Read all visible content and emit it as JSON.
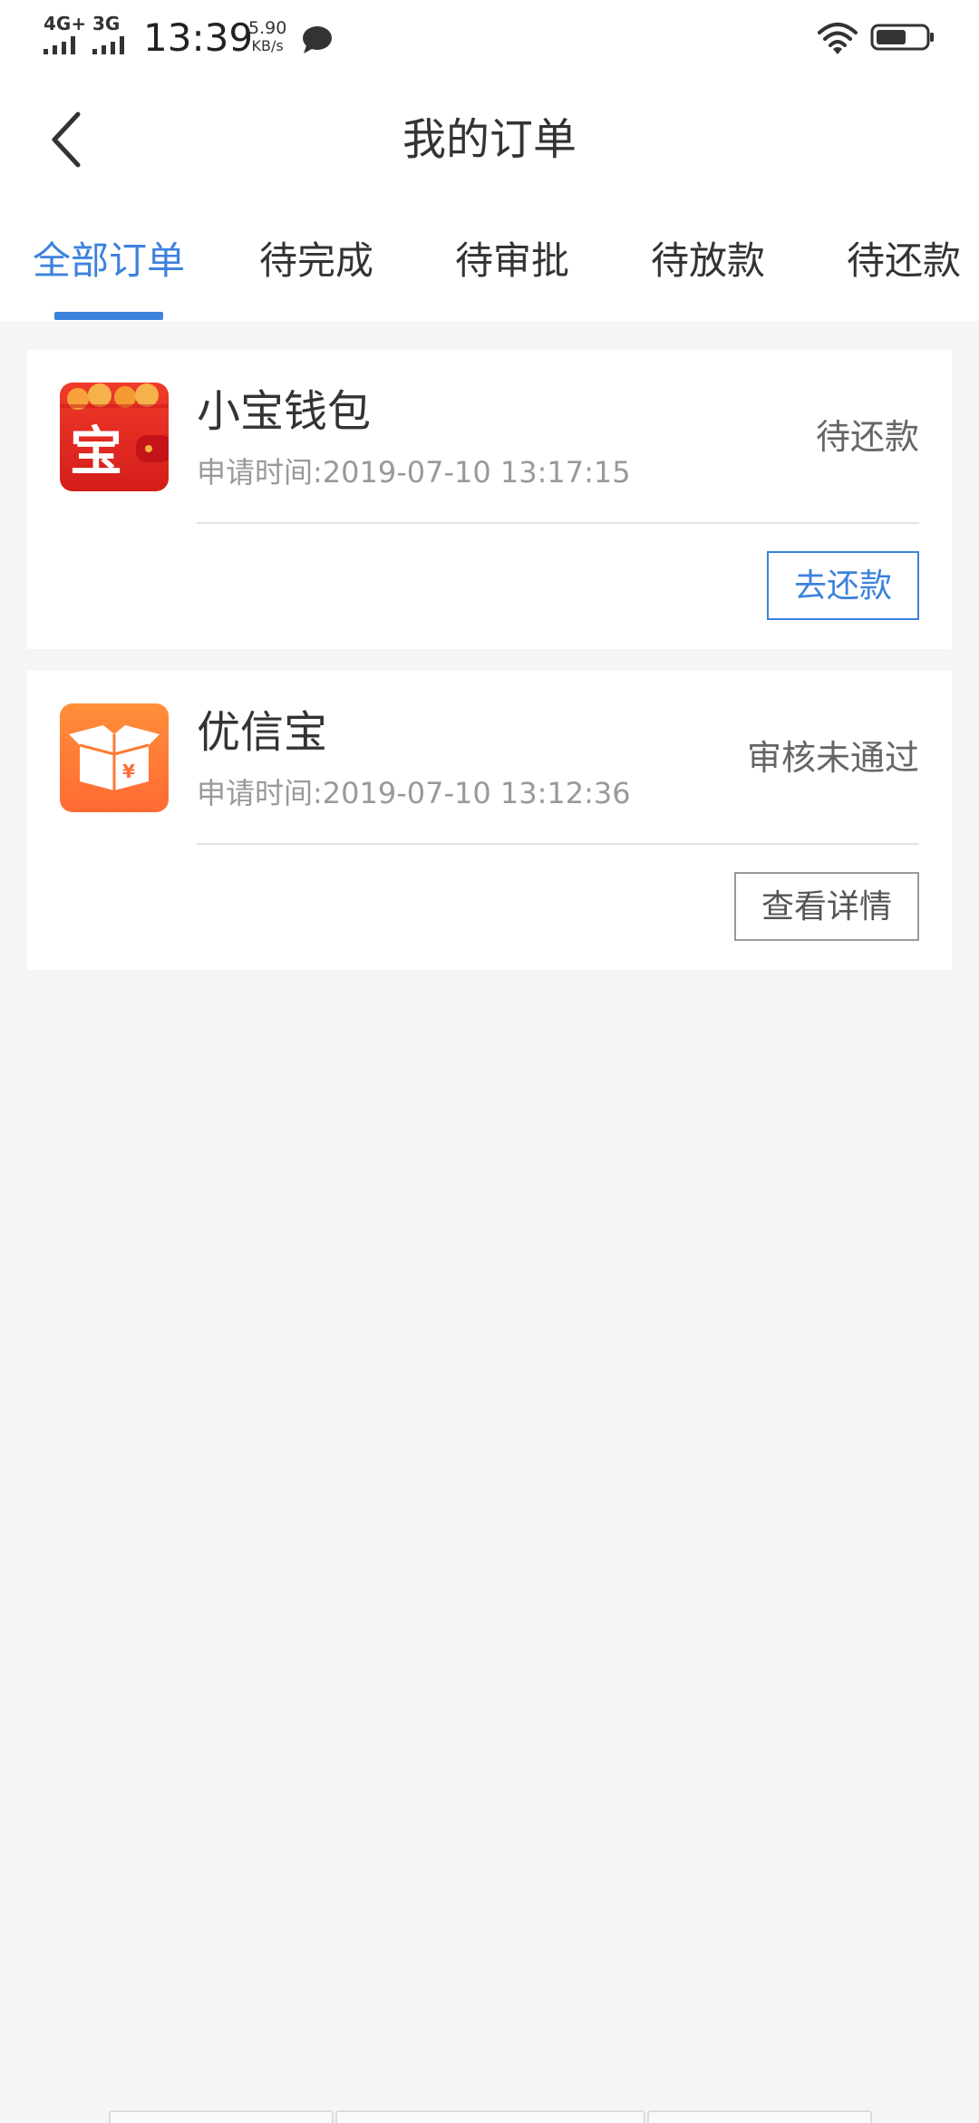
{
  "status_bar": {
    "network_1": "4G+",
    "network_2": "3G",
    "time": "13:39",
    "speed_value": "5.90",
    "speed_unit": "KB/s",
    "icons": [
      "message-icon",
      "wifi-icon",
      "battery-icon"
    ]
  },
  "header": {
    "title": "我的订单",
    "back_icon": "chevron-left-icon"
  },
  "tabs": [
    {
      "label": "全部订单",
      "active": true
    },
    {
      "label": "待完成",
      "active": false
    },
    {
      "label": "待审批",
      "active": false
    },
    {
      "label": "待放款",
      "active": false
    },
    {
      "label": "待还款",
      "active": false
    }
  ],
  "orders": [
    {
      "app_name": "小宝钱包",
      "apply_time": "申请时间:2019-07-10 13:17:15",
      "status": "待还款",
      "action_label": "去还款",
      "logo_icon": "wallet-bao-icon",
      "logo_glyph": "宝",
      "logo_color": "#e02a21"
    },
    {
      "app_name": "优信宝",
      "apply_time": "申请时间:2019-07-10 13:12:36",
      "status": "审核未通过",
      "action_label": "查看详情",
      "logo_icon": "open-box-yuan-icon",
      "logo_glyph": "¥",
      "logo_color": "#ff7c35"
    }
  ],
  "colors": {
    "accent": "#3d82dc",
    "background": "#f4f6f6",
    "card": "#ffffff",
    "text_primary": "#333333",
    "text_secondary": "#999999"
  }
}
